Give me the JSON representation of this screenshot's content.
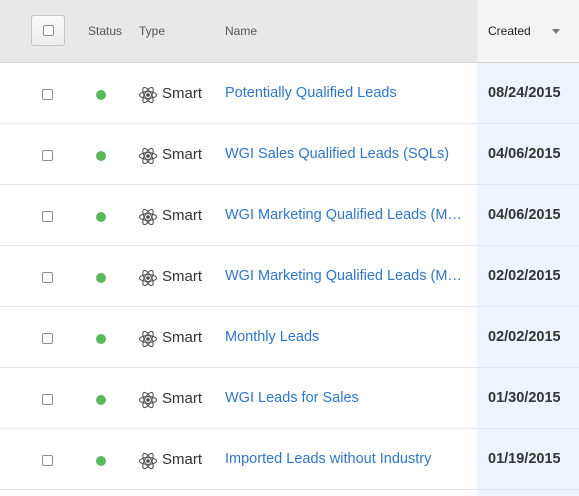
{
  "header": {
    "status": "Status",
    "type": "Type",
    "name": "Name",
    "created": "Created"
  },
  "colors": {
    "status_active": "#5cb85c",
    "link": "#2f76c7",
    "sorted_column_bg": "#edf4fd",
    "header_bg": "#e8e8e8"
  },
  "rows": [
    {
      "status": "active",
      "type_icon": "atom-icon",
      "type": "Smart",
      "name": "Potentially Qualified Leads",
      "created": "08/24/2015"
    },
    {
      "status": "active",
      "type_icon": "atom-icon",
      "type": "Smart",
      "name": "WGI Sales Qualified Leads (SQLs)",
      "created": "04/06/2015"
    },
    {
      "status": "active",
      "type_icon": "atom-icon",
      "type": "Smart",
      "name": "WGI Marketing Qualified Leads (MQ…",
      "created": "04/06/2015"
    },
    {
      "status": "active",
      "type_icon": "atom-icon",
      "type": "Smart",
      "name": "WGI Marketing Qualified Leads (MQ…",
      "created": "02/02/2015"
    },
    {
      "status": "active",
      "type_icon": "atom-icon",
      "type": "Smart",
      "name": "Monthly Leads",
      "created": "02/02/2015"
    },
    {
      "status": "active",
      "type_icon": "atom-icon",
      "type": "Smart",
      "name": "WGI Leads for Sales",
      "created": "01/30/2015"
    },
    {
      "status": "active",
      "type_icon": "atom-icon",
      "type": "Smart",
      "name": "Imported Leads without Industry",
      "created": "01/19/2015"
    }
  ]
}
